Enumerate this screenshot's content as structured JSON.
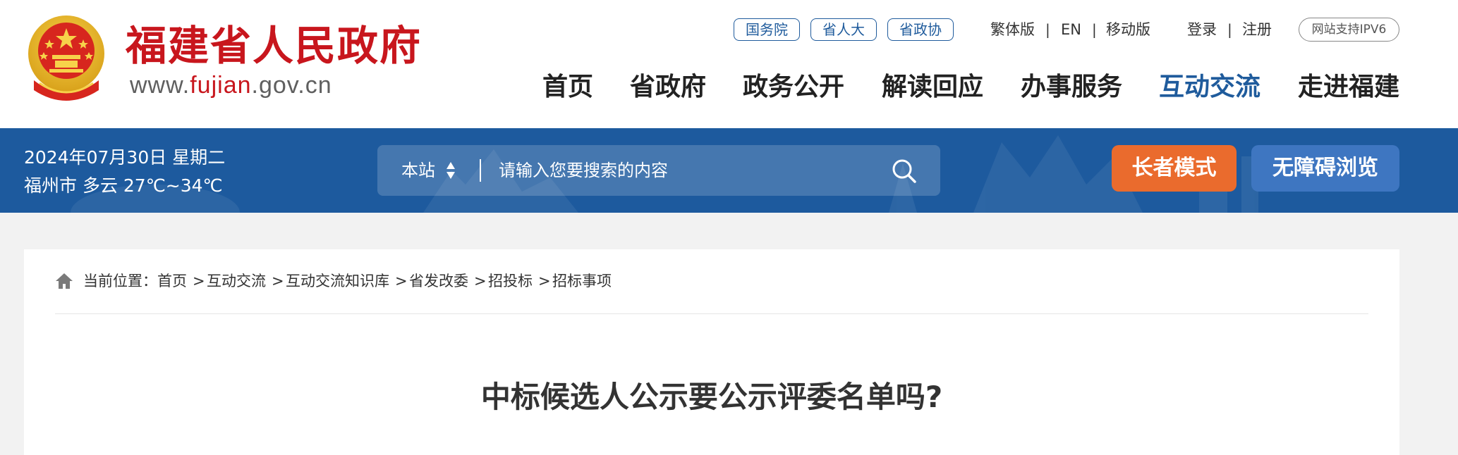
{
  "header": {
    "site_title": "福建省人民政府",
    "url_prefix": "www.",
    "url_brand": "fujian",
    "url_suffix": ".gov.cn",
    "pills": [
      "国务院",
      "省人大",
      "省政协"
    ],
    "links": {
      "traditional": "繁体版",
      "english": "EN",
      "mobile": "移动版",
      "login": "登录",
      "register": "注册",
      "separator": "|"
    },
    "ipv6_badge": "网站支持IPV6",
    "nav": [
      "首页",
      "省政府",
      "政务公开",
      "解读回应",
      "办事服务",
      "互动交流",
      "走进福建"
    ],
    "active_nav": "互动交流"
  },
  "infobar": {
    "date": "2024年07月30日 星期二",
    "weather": "福州市 多云 27℃~34℃",
    "search_scope": "本站",
    "search_placeholder": "请输入您要搜索的内容",
    "elder_mode": "长者模式",
    "accessible": "无障碍浏览"
  },
  "breadcrumb": {
    "prefix": "当前位置：",
    "items": [
      "首页",
      "互动交流",
      "互动交流知识库",
      "省发改委",
      "招投标",
      "招标事项"
    ],
    "separator": ">"
  },
  "article": {
    "title": "中标候选人公示要公示评委名单吗?"
  },
  "colors": {
    "brand_red": "#c8161d",
    "nav_blue": "#1f5b9c",
    "bar_blue": "#1d5a9e",
    "elder_orange": "#ea6b2d",
    "access_blue": "#3e76c1"
  }
}
